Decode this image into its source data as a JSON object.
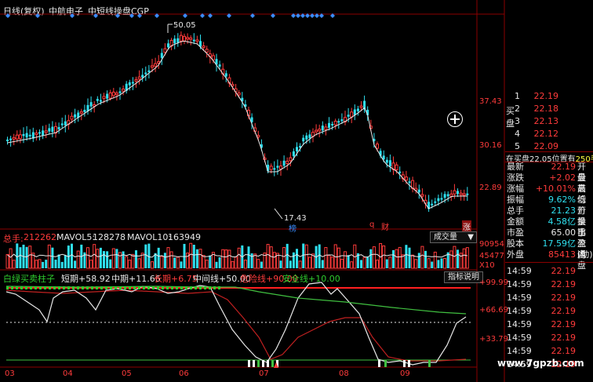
{
  "header": {
    "period_label": "日线(复权)",
    "stock_name": "中航电子",
    "indicator_name": "中短线操盘CGP"
  },
  "price_chart": {
    "high_label": "50.05",
    "low_label": "17.43",
    "y_ticks": [
      "37.43",
      "30.16",
      "22.89"
    ],
    "event_marks": [
      {
        "label": "榜",
        "color": "#3a8cff"
      },
      {
        "label": "q",
        "color": "#ff3b3b"
      },
      {
        "label": "财",
        "color": "#ff3b3b"
      },
      {
        "label": "涨",
        "color": "#e8e8e8"
      }
    ]
  },
  "volume": {
    "total_label": "总手:",
    "total_value": "212262",
    "mavol5_label": "MAVOL5:",
    "mavol5_value": "128278",
    "mavol10_label": "MAVOL10:",
    "mavol10_value": "163949",
    "dropdown": "成交量",
    "y_ticks": [
      "90954",
      "45477",
      "X10"
    ]
  },
  "indicator": {
    "name": "白绿买卖柱子",
    "items": [
      {
        "label": "短期",
        "value": "+58.92",
        "color": "#ffffff"
      },
      {
        "label": "中期",
        "value": "+11.66",
        "color": "#e8e8e8"
      },
      {
        "label": "长期",
        "value": "+6.75",
        "color": "#ff3b3b"
      },
      {
        "label": "中间线",
        "value": "+50.00",
        "color": "#e8e8e8"
      },
      {
        "label": "危险线",
        "value": "+90.00",
        "color": "#ff3b3b"
      },
      {
        "label": "安全线",
        "value": "+10.00",
        "color": "#2ecc2e"
      }
    ],
    "help_button": "指标说明",
    "y_ticks": [
      "+99.99",
      "+66.69",
      "+33.79"
    ]
  },
  "x_axis": [
    "03",
    "04",
    "05",
    "06",
    "07",
    "08",
    "09"
  ],
  "quote_panel": {
    "buy_label": "买盘",
    "asks": [
      {
        "level": "1",
        "price": "22.19",
        "vol": ""
      },
      {
        "level": "2",
        "price": "22.18",
        "vol": ""
      },
      {
        "level": "3",
        "price": "22.13",
        "vol": ""
      },
      {
        "level": "4",
        "price": "22.12",
        "vol": ""
      },
      {
        "level": "5",
        "price": "22.09",
        "vol": ""
      }
    ],
    "queue_text": "在买盘22.05位置有",
    "queue_vol": "250手",
    "queue_tail": "买",
    "fields": [
      {
        "k": "最新",
        "v": "22.19",
        "k2": "开盘",
        "color": "#ff3b3b"
      },
      {
        "k": "涨跌",
        "v": "+2.02",
        "k2": "最高",
        "color": "#ff3b3b"
      },
      {
        "k": "涨幅",
        "v": "+10.01%",
        "k2": "最低",
        "color": "#ff3b3b"
      },
      {
        "k": "振幅",
        "v": "9.62%",
        "k2": "均价",
        "color": "#2fe0f0"
      },
      {
        "k": "总手",
        "v": "21.23",
        "k2": "万量比",
        "color": "#2fe0f0"
      },
      {
        "k": "金额",
        "v": "4.58亿",
        "k2": "换手",
        "color": "#2fe0f0"
      },
      {
        "k": "市盈",
        "v": "65.00",
        "k2": "市盈(动)",
        "color": "#e8e8e8"
      },
      {
        "k": "股本",
        "v": "17.59亿",
        "k2": "流通",
        "color": "#2fe0f0"
      },
      {
        "k": "外盘",
        "v": "85413",
        "k2": "内盘",
        "color": "#ff3b3b"
      }
    ],
    "ticks": [
      {
        "time": "14:59",
        "price": "22.19",
        "vol": ""
      },
      {
        "time": "14:59",
        "price": "22.19",
        "vol": ""
      },
      {
        "time": "14:59",
        "price": "22.19",
        "vol": ""
      },
      {
        "time": "14:59",
        "price": "22.19",
        "vol": ""
      },
      {
        "time": "14:59",
        "price": "22.19",
        "vol": ""
      },
      {
        "time": "14:59",
        "price": "22.19",
        "vol": ""
      },
      {
        "time": "14:59",
        "price": "22.19",
        "vol": ""
      },
      {
        "time": "14:59",
        "price": "22.19",
        "vol": ""
      }
    ]
  },
  "watermark": "www.7gpzb.com",
  "colors": {
    "up": "#ff3b3b",
    "down": "#2fe0f0",
    "ma": "#e8e8e8",
    "short_line": "#e8e8e8",
    "mid_line": "#c02020",
    "long_line": "#40c040",
    "grid": "#8b0000"
  }
}
